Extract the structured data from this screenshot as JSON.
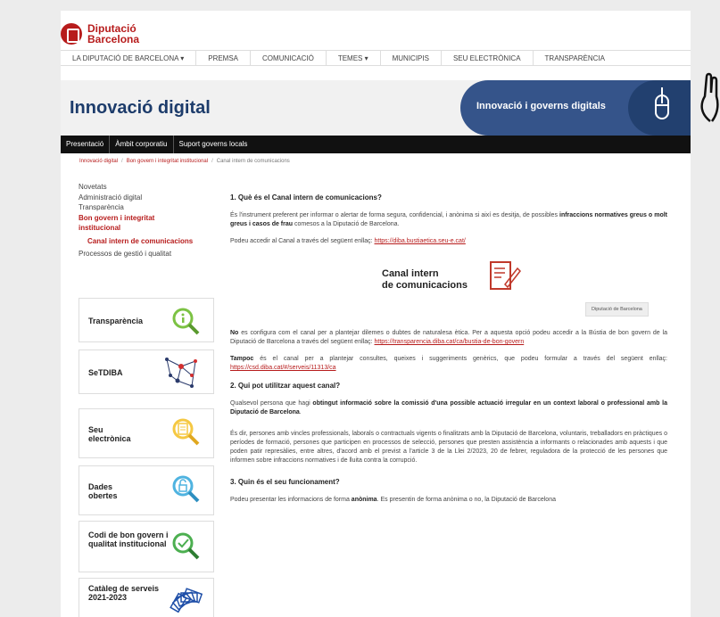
{
  "brand": {
    "name_line1": "Diputació",
    "name_line2": "Barcelona"
  },
  "topnav": [
    "LA DIPUTACIÓ DE BARCELONA ▾",
    "PREMSA",
    "COMUNICACIÓ",
    "TEMES ▾",
    "MUNICIPIS",
    "SEU ELECTRÒNICA",
    "TRANSPARÈNCIA"
  ],
  "band": {
    "title": "Innovació digital",
    "right_text": "Innovació i governs digitals"
  },
  "subnav": [
    "Presentació",
    "Àmbit corporatiu",
    "Suport governs locals"
  ],
  "breadcrumb": {
    "item1": "Innovació digital",
    "item2": "Bon govern i integritat institucional",
    "current": "Canal intern de comunicacions",
    "sep": "/"
  },
  "sidebar": {
    "links": [
      "Novetats",
      "Administració digital",
      "Transparència"
    ],
    "active": "Bon govern i integritat institucional",
    "sub_active": "Canal intern de comunicacions",
    "after": "Processos de gestió i qualitat"
  },
  "cards": [
    {
      "label": "Transparència",
      "icon": "magnifier-info-icon"
    },
    {
      "label": "SeTDIBA",
      "icon": "network-graph-icon"
    },
    {
      "label": "Seu electrònica",
      "icon": "magnifier-document-icon"
    },
    {
      "label": "Dades obertes",
      "icon": "magnifier-lock-icon"
    },
    {
      "label": "Codi de bon govern i qualitat institucional",
      "icon": "magnifier-check-icon"
    },
    {
      "label": "Catàleg de serveis 2021-2023",
      "icon": "fan-books-icon"
    }
  ],
  "main": {
    "q1": "1.   Què és el Canal intern de comunicacions?",
    "p1_a": "És l'instrument preferent per informar o alertar de forma segura, confidencial, i anònima si així es desitja, de possibles ",
    "p1_b": "infraccions normatives greus o molt greus i casos de frau",
    "p1_c": " comesos a la Diputació de Barcelona.",
    "p2_a": "Podeu accedir al Canal a través del següent enllaç: ",
    "p2_link": "https://diba.bustiaetica.seu-e.cat/",
    "banner_line1": "Canal intern",
    "banner_line2": "de comunicacions",
    "banner_tag": "Diputació de Barcelona",
    "p3_a": "No",
    "p3_b": " es configura com el canal per a plantejar dilemes o dubtes de naturalesa ètica. Per a aquesta opció podeu accedir a la Bústia de bon govern de la Diputació de Barcelona a través del següent enllaç: ",
    "p3_link": "https://transparencia.diba.cat/ca/bustia-de-bon-govern",
    "p4_a": "Tampoc",
    "p4_b": " és el canal per a plantejar consultes, queixes i suggeriments genèrics, que podeu formular a través del següent enllaç: ",
    "p4_link": "https://csd.diba.cat/#/serveis/11313/ca",
    "q2": "2.   Qui pot utilitzar aquest canal?",
    "p5_a": "Qualsevol persona que hagi ",
    "p5_b": "obtingut informació sobre la comissió d'una possible actuació irregular en un context laboral o professional amb la Diputació de Barcelona",
    "p5_c": ".",
    "p6": "És dir, persones amb vincles professionals, laborals o contractuals vigents o finalitzats amb la Diputació de Barcelona, voluntaris, treballadors en pràctiques o períodes de formació, persones que participen en processos de selecció, persones que presten assistència a informants o relacionades amb aquests i que poden patir represàlies, entre altres, d'acord amb el previst a l'article 3 de la Llei 2/2023, 20 de febrer, reguladora de la protecció de les persones que informen sobre infraccions normatives i de lluita contra la corrupció.",
    "q3": "3.   Quin és el seu funcionament?",
    "p7_a": "Podeu presentar les informacions de forma ",
    "p7_b": "anònima",
    "p7_c": ". Es presentin de forma anònima o no, la Diputació de Barcelona"
  }
}
